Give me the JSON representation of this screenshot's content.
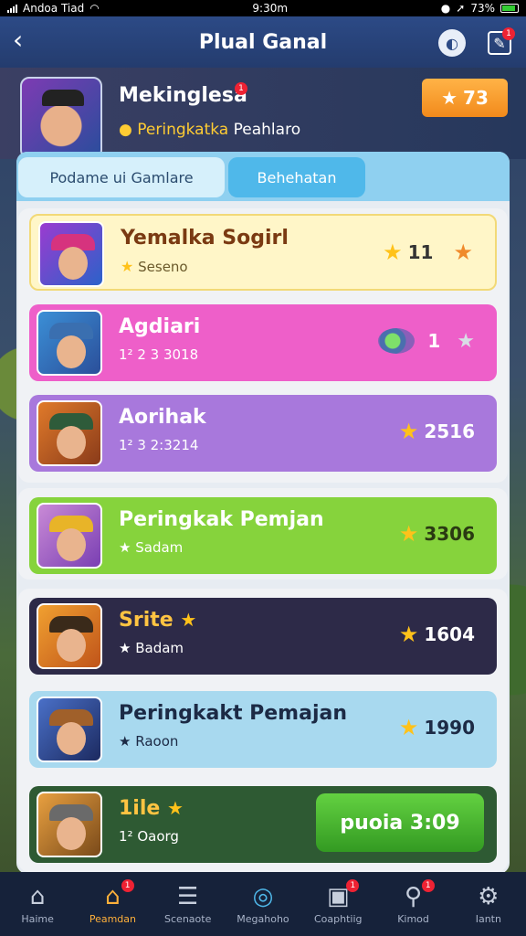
{
  "status_bar": {
    "carrier": "Andoa Tiad",
    "time": "9:30m",
    "battery": "73%"
  },
  "header": {
    "title": "Plual Ganal",
    "back_icon": "back-chevron-icon",
    "world_icon": "globe-icon",
    "edit_icon": "edit-icon",
    "edit_badge": "1"
  },
  "profile": {
    "name": "Mekinglesa",
    "name_badge": "1",
    "rank_label": "Peringkatka",
    "rank_sub": "Peahlaro",
    "score": "73"
  },
  "tabs": [
    {
      "label": "Podame ui Gamlare"
    },
    {
      "label": "Behehatan"
    }
  ],
  "rows": [
    {
      "name": "Yemalka Sogirl",
      "sub": "Seseno",
      "score": "11",
      "color": "#fff6c8",
      "name_color": "#7a3a12"
    },
    {
      "name": "Agdiari",
      "sub": "1² 2 3 3018",
      "score": "1",
      "color": "#ee5fc9"
    },
    {
      "name": "Aorihak",
      "sub": "1² 3 2:3214",
      "score": "2516",
      "color": "#a878dc"
    },
    {
      "name": "Peringkak Pemjan",
      "sub": "Sadam",
      "score": "3306",
      "color": "#86d33c"
    },
    {
      "name": "Srite",
      "sub": "Badam",
      "score": "1604",
      "color": "#2d2a48",
      "name_color": "#ffc442"
    },
    {
      "name": "Peringkakt Pemajan",
      "sub": "Raoon",
      "score": "1990",
      "color": "#a8d9ef",
      "name_color": "#1c2a45"
    },
    {
      "name": "1ile",
      "sub": "1² Oaorg",
      "button": "puoia 3:09",
      "color": "#2e5a33",
      "name_color": "#ffc442"
    }
  ],
  "bottom_nav": [
    {
      "label": "Haime",
      "icon": "home-icon"
    },
    {
      "label": "Peamdan",
      "icon": "house-badge-icon",
      "badge": "1"
    },
    {
      "label": "Scenaote",
      "icon": "list-icon"
    },
    {
      "label": "Megahoho",
      "icon": "compass-icon"
    },
    {
      "label": "Coaphtiig",
      "icon": "store-icon",
      "badge": "1"
    },
    {
      "label": "Kimod",
      "icon": "search-icon",
      "badge": "1"
    },
    {
      "label": "Iantn",
      "icon": "gear-icon"
    }
  ]
}
